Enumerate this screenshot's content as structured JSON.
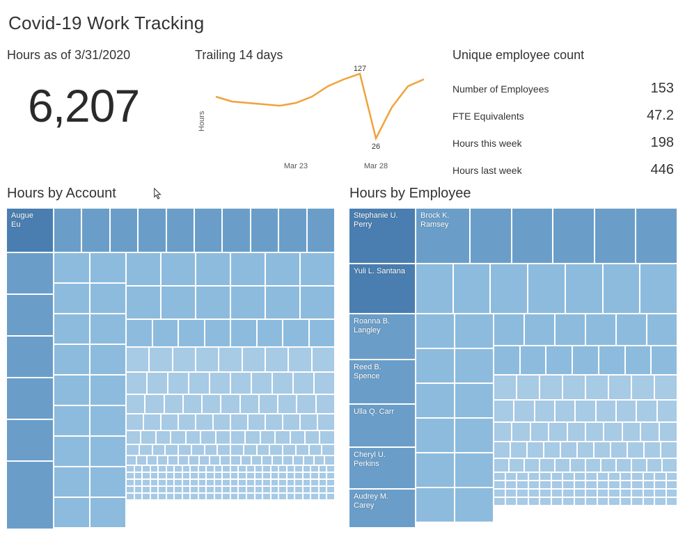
{
  "title": "Covid-19 Work Tracking",
  "kpi": {
    "heading": "Hours as of 3/31/2020",
    "value": "6,207"
  },
  "sparkline": {
    "heading": "Trailing 14 days",
    "ylabel": "Hours",
    "max_label": "127",
    "min_label": "26",
    "x_ticks": [
      "Mar 23",
      "Mar 28"
    ]
  },
  "stats": {
    "heading": "Unique employee count",
    "rows": [
      {
        "label": "Number of Employees",
        "value": "153"
      },
      {
        "label": "FTE Equivalents",
        "value": "47.2"
      },
      {
        "label": "Hours this week",
        "value": "198"
      },
      {
        "label": "Hours last week",
        "value": "446"
      }
    ]
  },
  "treemap_account": {
    "heading": "Hours by Account",
    "top_label": "Augue\nEu"
  },
  "treemap_employee": {
    "heading": "Hours by Employee",
    "labels": [
      "Stephanie U.\nPerry",
      "Yuli L. Santana",
      "Roanna B.\nLangley",
      "Reed B.\nSpence",
      "Ulla Q. Carr",
      "Cheryl U.\nPerkins",
      "Audrey M.\nCarey"
    ],
    "second_col_top_label": "Brock K.\nRamsey"
  },
  "colors": {
    "dark": "#4a7eb0",
    "mid": "#6a9ec9",
    "light": "#8dbbdd",
    "vlight": "#a7cae5",
    "line": "#f0a23a"
  },
  "chart_data": [
    {
      "type": "line",
      "title": "Trailing 14 days",
      "ylabel": "Hours",
      "x": [
        1,
        2,
        3,
        4,
        5,
        6,
        7,
        8,
        9,
        10,
        11,
        12,
        13,
        14
      ],
      "values": [
        80,
        72,
        70,
        68,
        65,
        70,
        80,
        100,
        115,
        127,
        26,
        70,
        105,
        118
      ],
      "x_tick_labels": {
        "6": "Mar 23",
        "11": "Mar 28"
      },
      "ylim": [
        0,
        140
      ],
      "annotated_points": {
        "max": 127,
        "min": 26
      }
    },
    {
      "type": "treemap",
      "title": "Hours by Account",
      "note": "Only top item label visible",
      "items": [
        {
          "name": "Augue Eu",
          "rank": 1
        }
      ]
    },
    {
      "type": "treemap",
      "title": "Hours by Employee",
      "note": "Only top item labels visible",
      "items": [
        {
          "name": "Stephanie U. Perry",
          "rank": 1
        },
        {
          "name": "Brock K. Ramsey",
          "rank": 2
        },
        {
          "name": "Yuli L. Santana",
          "rank": 3
        },
        {
          "name": "Roanna B. Langley",
          "rank": 4
        },
        {
          "name": "Reed B. Spence",
          "rank": 5
        },
        {
          "name": "Ulla Q. Carr",
          "rank": 6
        },
        {
          "name": "Cheryl U. Perkins",
          "rank": 7
        },
        {
          "name": "Audrey M. Carey",
          "rank": 8
        }
      ]
    }
  ]
}
